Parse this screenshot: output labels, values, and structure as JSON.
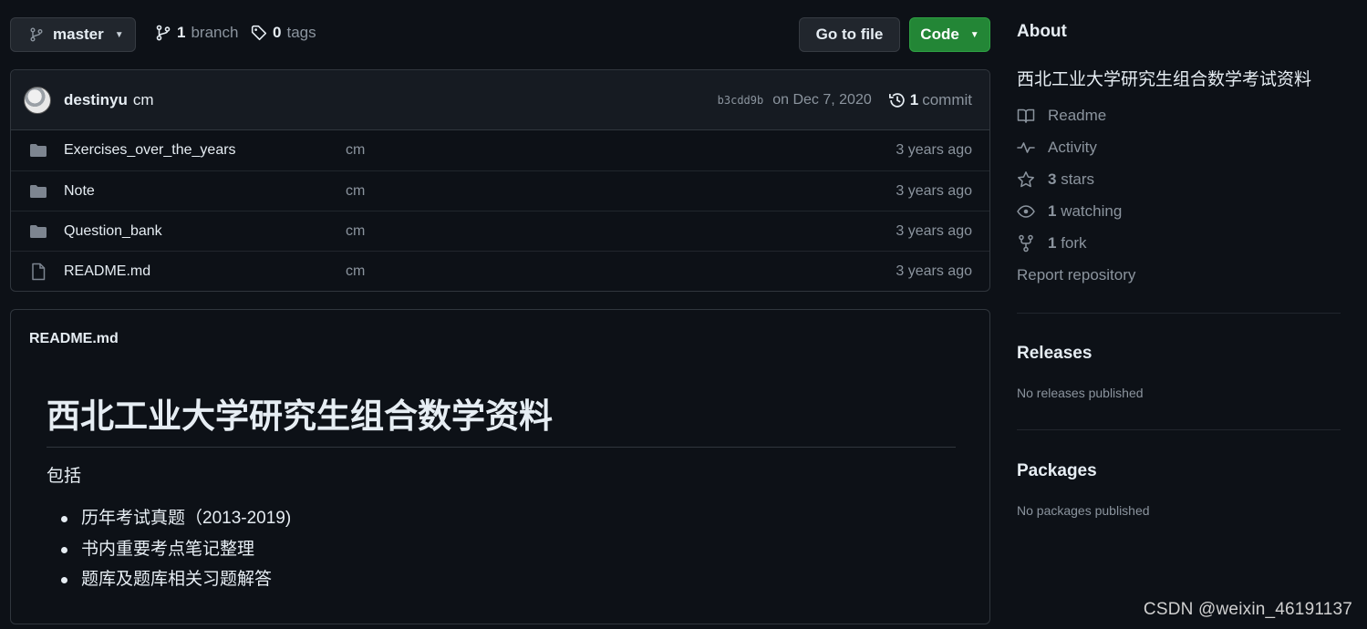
{
  "toolbar": {
    "branch_name": "master",
    "branch_count": "1",
    "branch_label": "branch",
    "tag_count": "0",
    "tag_label": "tags",
    "goto_file_label": "Go to file",
    "code_label": "Code"
  },
  "commit": {
    "author": "destinyu",
    "message": "cm",
    "sha": "b3cdd9b",
    "date": "on Dec 7, 2020",
    "count": "1",
    "count_label": "commit"
  },
  "files": [
    {
      "type": "folder",
      "name": "Exercises_over_the_years",
      "message": "cm",
      "age": "3 years ago"
    },
    {
      "type": "folder",
      "name": "Note",
      "message": "cm",
      "age": "3 years ago"
    },
    {
      "type": "folder",
      "name": "Question_bank",
      "message": "cm",
      "age": "3 years ago"
    },
    {
      "type": "file",
      "name": "README.md",
      "message": "cm",
      "age": "3 years ago"
    }
  ],
  "readme": {
    "filename": "README.md",
    "heading": "西北工业大学研究生组合数学资料",
    "intro": "包括",
    "items": [
      "历年考试真题（2013-2019)",
      "书内重要考点笔记整理",
      "题库及题库相关习题解答"
    ]
  },
  "about": {
    "heading": "About",
    "description": "西北工业大学研究生组合数学考试资料",
    "readme_label": "Readme",
    "activity_label": "Activity",
    "stars_count": "3",
    "stars_label": "stars",
    "watching_count": "1",
    "watching_label": "watching",
    "fork_count": "1",
    "fork_label": "fork",
    "report_label": "Report repository"
  },
  "releases": {
    "heading": "Releases",
    "note": "No releases published"
  },
  "packages": {
    "heading": "Packages",
    "note": "No packages published"
  },
  "watermark": "CSDN @weixin_46191137",
  "icons": {
    "branch": "git-branch-icon",
    "tag": "tag-icon",
    "history": "history-icon",
    "folder": "folder-icon",
    "file": "file-icon",
    "book": "book-icon",
    "pulse": "pulse-icon",
    "star": "star-icon",
    "eye": "eye-icon",
    "fork": "repo-forked-icon"
  },
  "colors": {
    "background": "#0d1117",
    "code_button": "#238636",
    "muted_text": "#8b949e",
    "border": "#30363d"
  }
}
